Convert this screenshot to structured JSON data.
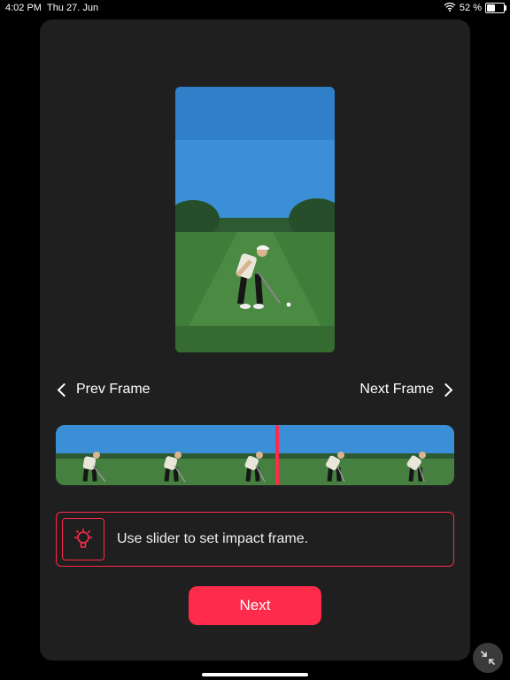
{
  "status": {
    "time": "4:02 PM",
    "date": "Thu 27. Jun",
    "wifi_icon": "wifi-icon",
    "battery_text": "52 %",
    "battery_level_pct": 52
  },
  "colors": {
    "accent": "#ff2b4a",
    "panel": "#1f1f1f"
  },
  "preview": {
    "description": "golfer-at-impact-on-fairway"
  },
  "frame_nav": {
    "prev_label": "Prev Frame",
    "next_label": "Next Frame"
  },
  "filmstrip": {
    "thumb_count": 5,
    "playhead_position_pct": 55
  },
  "hint": {
    "icon": "lightbulb-icon",
    "text": "Use slider to set impact frame."
  },
  "primary_button": {
    "label": "Next"
  },
  "fab": {
    "icon": "minimize-icon"
  }
}
